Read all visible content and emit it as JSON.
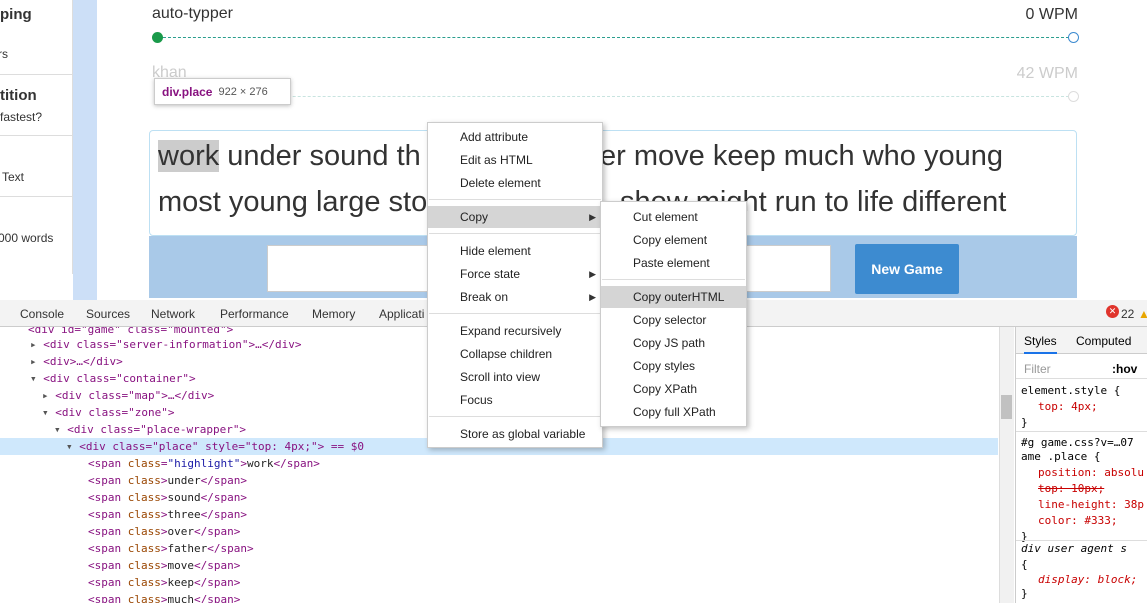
{
  "sidebar": {
    "items": [
      "ping",
      "rs",
      "tition",
      "fastest?",
      "Text",
      "000 words"
    ]
  },
  "race": {
    "racers": [
      {
        "name": "auto-typper",
        "wpm": "0 WPM"
      },
      {
        "name": "khan",
        "wpm": "42 WPM"
      }
    ],
    "text_line1_highlight": "work",
    "text_line1_rest": " under sound th",
    "text_line1_tail": "er move keep much who young",
    "text_line2_head": "most young large sto",
    "text_line2_tail": "show might run to life different",
    "new_game_label": "New Game"
  },
  "tooltip": {
    "selector": "div.place",
    "size": "922 × 276"
  },
  "devtools": {
    "tabs": [
      "Console",
      "Sources",
      "Network",
      "Performance",
      "Memory",
      "Applicati"
    ],
    "errors": "22",
    "dom_lines": [
      "<div id=\"game\" class=\"mounted\">",
      "<div class=\"server-information\">…</div>",
      "<div>…</div>",
      "<div class=\"container\">",
      "<div class=\"map\">…</div>",
      "<div class=\"zone\">",
      "<div class=\"place-wrapper\">",
      "<div class=\"place\" style=\"top: 4px;\"> == $0"
    ],
    "spans": [
      "work",
      "under",
      "sound",
      "three",
      "over",
      "father",
      "move",
      "keep",
      "much"
    ],
    "styles_tabs": [
      "Styles",
      "Computed"
    ],
    "filter_placeholder": "Filter",
    "hov": ":hov",
    "style_lines": [
      "element.style {",
      "top: 4px;",
      "}",
      "#g  game.css?v=…07",
      "ame .place {",
      "position: absolu",
      "top: 10px;",
      "line-height: 38p",
      "color: #333;",
      "}",
      "div   user agent s",
      "{",
      "display: block;",
      "}"
    ]
  },
  "context_menu": {
    "items": [
      "Add attribute",
      "Edit as HTML",
      "Delete element",
      "Copy",
      "Hide element",
      "Force state",
      "Break on",
      "Expand recursively",
      "Collapse children",
      "Scroll into view",
      "Focus",
      "Store as global variable"
    ]
  },
  "copy_submenu": {
    "items": [
      "Cut element",
      "Copy element",
      "Paste element",
      "Copy outerHTML",
      "Copy selector",
      "Copy JS path",
      "Copy styles",
      "Copy XPath",
      "Copy full XPath"
    ]
  },
  "colors": {
    "accent": "#3d8bd0",
    "progress": "#2b9e8e",
    "tag": "#881280"
  }
}
